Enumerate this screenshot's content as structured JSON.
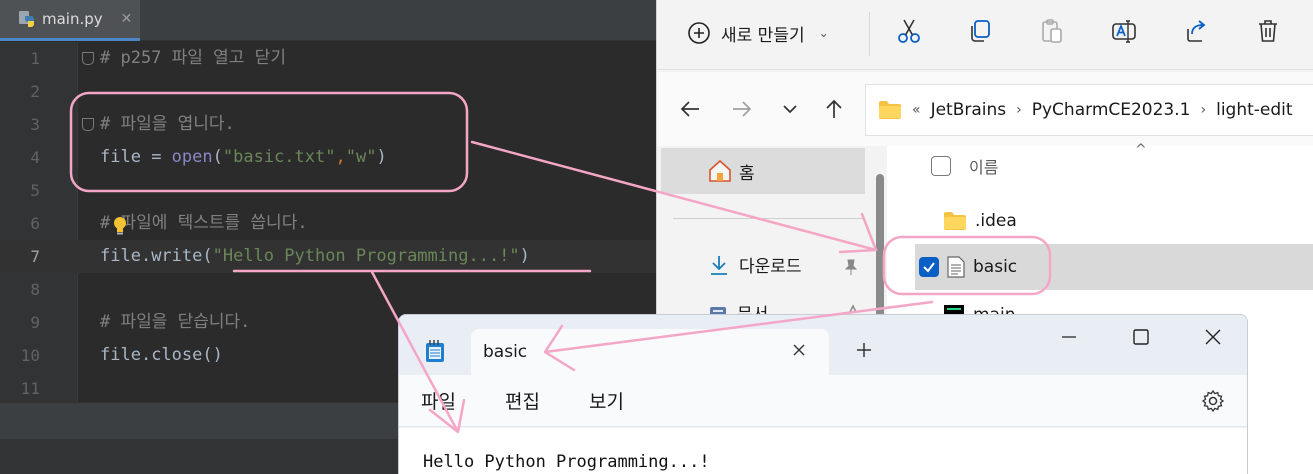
{
  "editor": {
    "tab_label": "main.py",
    "tab_close": "✕",
    "lines": [
      {
        "num": "1"
      },
      {
        "num": "2"
      },
      {
        "num": "3"
      },
      {
        "num": "4"
      },
      {
        "num": "5"
      },
      {
        "num": "6"
      },
      {
        "num": "7"
      },
      {
        "num": "8"
      },
      {
        "num": "9"
      },
      {
        "num": "10"
      },
      {
        "num": "11"
      }
    ],
    "code": {
      "l1": "# p257 파일 열고 닫기",
      "l3": "# 파일을 엽니다.",
      "l4_var": "file",
      "l4_eq": " = ",
      "l4_func": "open",
      "l4_p1": "(",
      "l4_s1": "\"basic.txt\"",
      "l4_comma": ",",
      "l4_s2": "\"w\"",
      "l4_p2": ")",
      "l6": "# 파일에 텍스트를 씁니다.",
      "l7_var": "file",
      "l7_method": ".write(",
      "l7_str": "\"Hello Python Programming...!\"",
      "l7_end": ")",
      "l9": "# 파일을 닫습니다.",
      "l10_var": "file",
      "l10_method": ".close()"
    },
    "current_line": 7
  },
  "explorer": {
    "toolbar": {
      "new_label": "새로 만들기",
      "new_chevron": "⌄"
    },
    "breadcrumb": {
      "prefix": "«",
      "items": [
        "JetBrains",
        "PyCharmCE2023.1",
        "light-edit"
      ],
      "separator": "›"
    },
    "nav": {
      "home": "홈",
      "downloads": "다운로드",
      "documents": "문서"
    },
    "column_name": "이름",
    "sort_indicator": "^",
    "files": [
      {
        "name": ".idea",
        "type": "folder"
      },
      {
        "name": "basic",
        "type": "text",
        "selected": true
      },
      {
        "name": "main",
        "type": "pycharm"
      }
    ]
  },
  "notepad": {
    "tab_label": "basic",
    "menu": [
      "파일",
      "편집",
      "보기"
    ],
    "content": "Hello Python Programming...!"
  },
  "colors": {
    "annotation": "#f4a6c6",
    "accent_blue": "#0a5fc4"
  }
}
